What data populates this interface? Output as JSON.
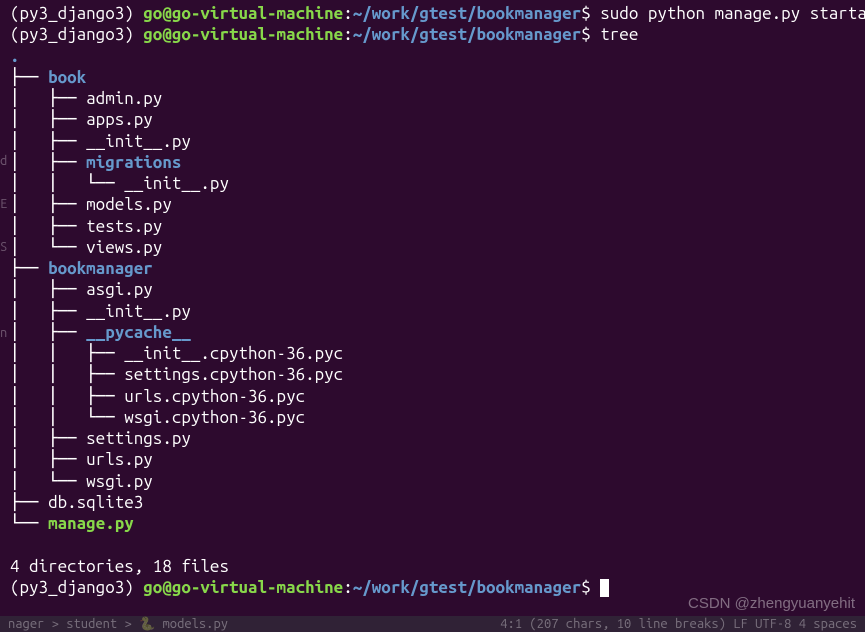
{
  "prompt1": {
    "env": "(py3_django3) ",
    "userhost": "go@go-virtual-machine",
    "colon": ":",
    "path": "~/work/gtest/bookmanager",
    "sign": "$ ",
    "cmd": "sudo python manage.py startapp book"
  },
  "prompt2": {
    "env": "(py3_django3) ",
    "userhost": "go@go-virtual-machine",
    "colon": ":",
    "path": "~/work/gtest/bookmanager",
    "sign": "$ ",
    "cmd": "tree"
  },
  "tree": {
    "root": ".",
    "l1": "├── ",
    "l1_name": "book",
    "l2": "│   ├── admin.py",
    "l3": "│   ├── apps.py",
    "l4": "│   ├── __init__.py",
    "l5": "│   ├── ",
    "l5_name": "migrations",
    "l6": "│   │   └── __init__.py",
    "l7": "│   ├── models.py",
    "l8": "│   ├── tests.py",
    "l9": "│   └── views.py",
    "l10": "├── ",
    "l10_name": "bookmanager",
    "l11": "│   ├── asgi.py",
    "l12": "│   ├── __init__.py",
    "l13": "│   ├── ",
    "l13_name": "__pycache__",
    "l14": "│   │   ├── __init__.cpython-36.pyc",
    "l15": "│   │   ├── settings.cpython-36.pyc",
    "l16": "│   │   ├── urls.cpython-36.pyc",
    "l17": "│   │   └── wsgi.cpython-36.pyc",
    "l18": "│   ├── settings.py",
    "l19": "│   ├── urls.py",
    "l20": "│   └── wsgi.py",
    "l21": "├── db.sqlite3",
    "l22": "└── ",
    "l22_name": "manage.py"
  },
  "summary": "4 directories, 18 files",
  "prompt3": {
    "env": "(py3_django3) ",
    "userhost": "go@go-virtual-machine",
    "colon": ":",
    "path": "~/work/gtest/bookmanager",
    "sign": "$ "
  },
  "watermark": "CSDN @zhengyuanyehit",
  "status_left": "nager > student > 🐍 models.py",
  "status_right": "4:1 (207 chars, 10 line breaks)  LF  UTF-8  4 spaces"
}
